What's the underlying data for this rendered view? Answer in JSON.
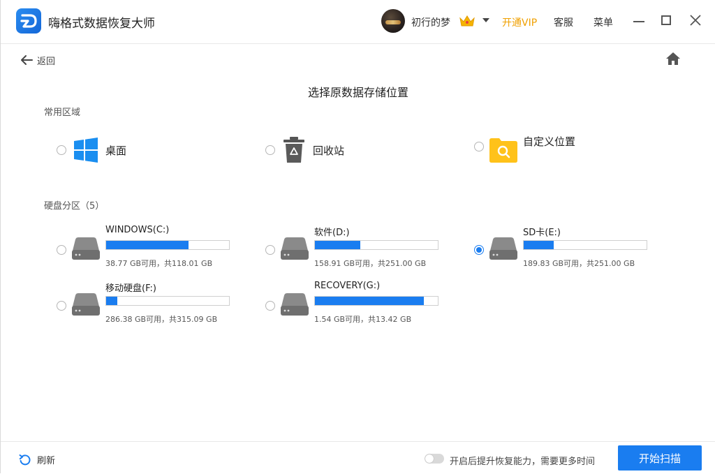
{
  "app": {
    "title": "嗨格式数据恢复大师"
  },
  "header": {
    "username": "初行的梦",
    "vip_label": "开通VIP",
    "service_label": "客服",
    "menu_label": "菜单"
  },
  "nav": {
    "back_label": "返回"
  },
  "page": {
    "title": "选择原数据存储位置"
  },
  "common": {
    "section_label": "常用区域",
    "items": [
      {
        "label": "桌面",
        "icon": "windows-icon"
      },
      {
        "label": "回收站",
        "icon": "recycle-bin-icon"
      },
      {
        "label": "自定义位置",
        "icon": "folder-search-icon"
      }
    ]
  },
  "drives": {
    "section_label": "硬盘分区（5）",
    "items": [
      {
        "name": "WINDOWS(C:)",
        "info": "38.77 GB可用，共118.01 GB",
        "used_fraction": 0.671,
        "selected": false
      },
      {
        "name": "软件(D:)",
        "info": "158.91 GB可用，共251.00 GB",
        "used_fraction": 0.367,
        "selected": false
      },
      {
        "name": "SD卡(E:)",
        "info": "189.83 GB可用，共251.00 GB",
        "used_fraction": 0.244,
        "selected": true
      },
      {
        "name": "移动硬盘(F:)",
        "info": "286.38 GB可用，共315.09 GB",
        "used_fraction": 0.091,
        "selected": false
      },
      {
        "name": "RECOVERY(G:)",
        "info": "1.54 GB可用，共13.42 GB",
        "used_fraction": 0.885,
        "selected": false
      }
    ]
  },
  "footer": {
    "refresh_label": "刷新",
    "toggle_label": "开启后提升恢复能力，需要更多时间",
    "scan_button": "开始扫描"
  },
  "colors": {
    "accent": "#1a7df0",
    "vip": "#f0a000"
  }
}
